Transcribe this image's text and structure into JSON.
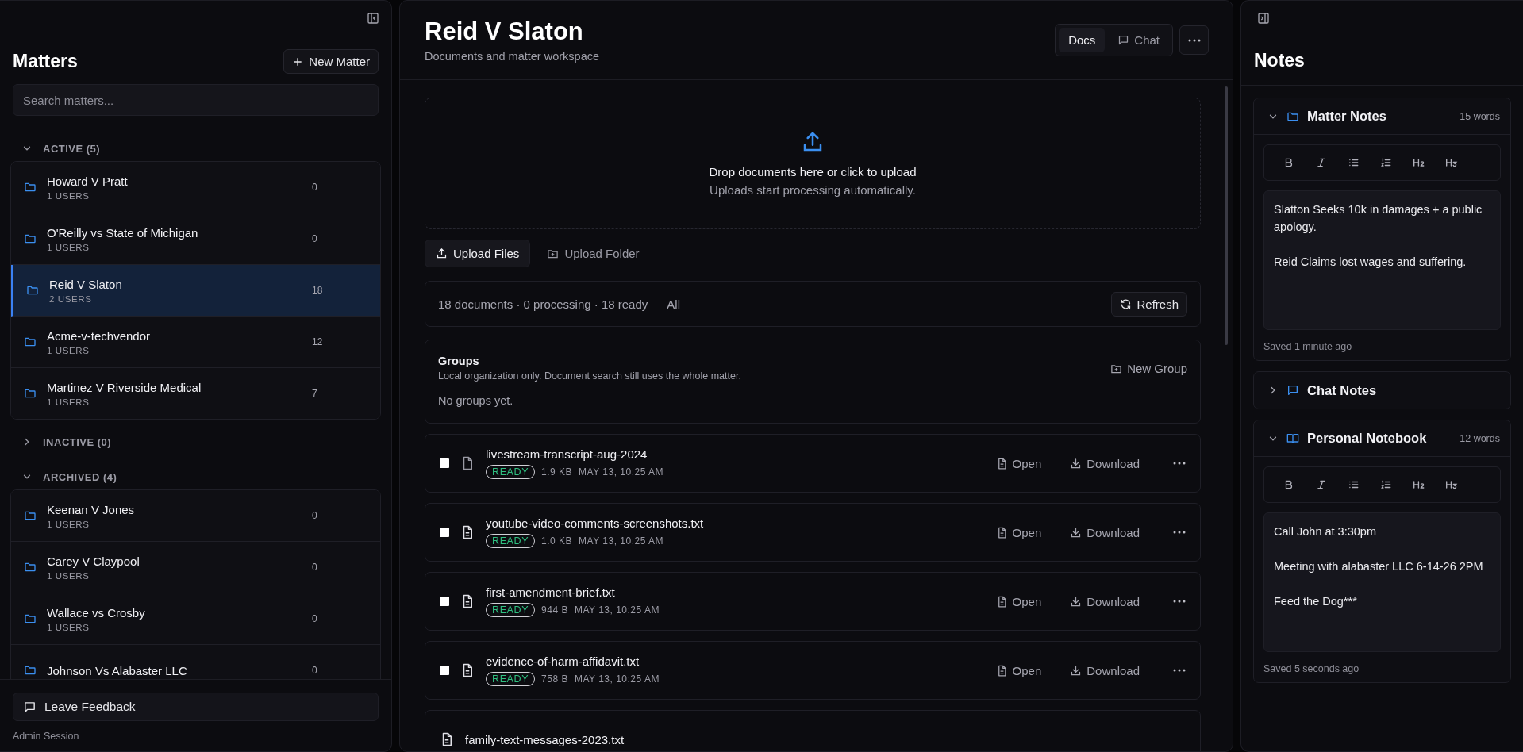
{
  "matters_panel": {
    "title": "Matters",
    "new_button": "New Matter",
    "search": {
      "placeholder": "Search matters..."
    },
    "sections": [
      {
        "label": "ACTIVE (5)",
        "expanded": true,
        "items": [
          {
            "name": "Howard V Pratt",
            "users": "1 USERS",
            "count": "0",
            "selected": false
          },
          {
            "name": "O'Reilly vs State of Michigan",
            "users": "1 USERS",
            "count": "0",
            "selected": false
          },
          {
            "name": "Reid V Slaton",
            "users": "2 USERS",
            "count": "18",
            "selected": true
          },
          {
            "name": "Acme-v-techvendor",
            "users": "1 USERS",
            "count": "12",
            "selected": false
          },
          {
            "name": "Martinez V Riverside Medical",
            "users": "1 USERS",
            "count": "7",
            "selected": false
          }
        ]
      },
      {
        "label": "INACTIVE (0)",
        "expanded": false
      },
      {
        "label": "ARCHIVED (4)",
        "expanded": true,
        "items": [
          {
            "name": "Keenan V Jones",
            "users": "1 USERS",
            "count": "0",
            "selected": false
          },
          {
            "name": "Carey V Claypool",
            "users": "1 USERS",
            "count": "0",
            "selected": false
          },
          {
            "name": "Wallace vs Crosby",
            "users": "1 USERS",
            "count": "0",
            "selected": false
          },
          {
            "name": "Johnson Vs Alabaster LLC",
            "count": "0",
            "selected": false
          }
        ]
      }
    ],
    "feedback_button": "Leave Feedback",
    "session": "Admin Session"
  },
  "workspace": {
    "title": "Reid V Slaton",
    "subtitle": "Documents and matter workspace",
    "view_tabs": [
      {
        "label": "Docs",
        "selected": true
      },
      {
        "label": "Chat",
        "selected": false
      }
    ],
    "upload_zone": {
      "title": "Drop documents here or click to upload",
      "hint": "Uploads start processing automatically."
    },
    "upload_buttons": [
      {
        "label": "Upload Files",
        "kind": "file",
        "selected": true
      },
      {
        "label": "Upload Folder",
        "kind": "folder",
        "selected": false
      }
    ],
    "stats": "18 documents · 0 processing · 18 ready",
    "filter": "All",
    "refresh_button": "Refresh",
    "groups": {
      "title": "Groups",
      "description": "Local organization only. Document search still uses the whole matter.",
      "new_button": "New Group",
      "empty": "No groups yet."
    },
    "documents": [
      {
        "name": "livestream-transcript-aug-2024",
        "kind": "file",
        "checked": false,
        "status": "READY",
        "size": "1.9 KB",
        "date": "MAY 13, 10:25 AM",
        "open": "Open",
        "download": "Download"
      },
      {
        "name": "youtube-video-comments-screenshots.txt",
        "kind": "text",
        "checked": false,
        "status": "READY",
        "size": "1.0 KB",
        "date": "MAY 13, 10:25 AM",
        "open": "Open",
        "download": "Download"
      },
      {
        "name": "first-amendment-brief.txt",
        "kind": "text",
        "checked": false,
        "status": "READY",
        "size": "944 B",
        "date": "MAY 13, 10:25 AM",
        "open": "Open",
        "download": "Download"
      },
      {
        "name": "evidence-of-harm-affidavit.txt",
        "kind": "text",
        "checked": false,
        "status": "READY",
        "size": "758 B",
        "date": "MAY 13, 10:25 AM",
        "open": "Open",
        "download": "Download"
      },
      {
        "name": "family-text-messages-2023.txt",
        "kind": "text"
      }
    ]
  },
  "notes_panel": {
    "title": "Notes",
    "sections": [
      {
        "title": "Matter Notes",
        "kind": "folder",
        "expanded": true,
        "word_count": "15 words",
        "paragraphs": [
          "Slatton Seeks 10k in damages + a public apology.",
          "Reid Claims lost wages and suffering."
        ],
        "saved": "Saved 1 minute ago"
      },
      {
        "title": "Chat Notes",
        "kind": "chat",
        "expanded": false
      },
      {
        "title": "Personal Notebook",
        "kind": "book",
        "expanded": true,
        "word_count": "12 words",
        "paragraphs": [
          "Call John at 3:30pm",
          "Meeting with alabaster LLC 6-14-26 2PM",
          "Feed the Dog***"
        ],
        "saved": "Saved 5 seconds ago"
      }
    ]
  }
}
